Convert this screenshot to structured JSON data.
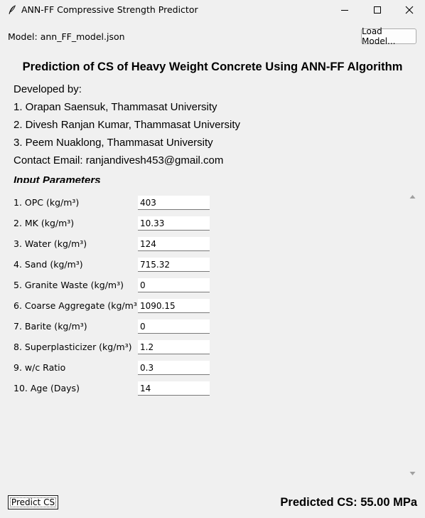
{
  "window": {
    "title": "ANN-FF Compressive Strength Predictor",
    "app_icon": "feather-icon",
    "controls": [
      "minimize-icon",
      "maximize-icon",
      "close-icon"
    ]
  },
  "toolbar": {
    "model_label": "Model: ann_FF_model.json",
    "load_button": "Load Model..."
  },
  "header": {
    "title": "Prediction of CS of Heavy Weight Concrete Using ANN-FF Algorithm"
  },
  "info": {
    "developed_by": "Developed by:",
    "authors": [
      "1. Orapan Saensuk, Thammasat University",
      "2. Divesh Ranjan Kumar, Thammasat University",
      "3. Peem Nuaklong, Thammasat University"
    ],
    "contact": "Contact Email: ranjandivesh453@gmail.com"
  },
  "inputs": {
    "section_label": "Input Parameters",
    "params": [
      {
        "label": "1. OPC (kg/m³)",
        "value": "403"
      },
      {
        "label": "2. MK (kg/m³)",
        "value": "10.33"
      },
      {
        "label": "3. Water (kg/m³)",
        "value": "124"
      },
      {
        "label": "4. Sand (kg/m³)",
        "value": "715.32"
      },
      {
        "label": "5. Granite Waste (kg/m³)",
        "value": "0"
      },
      {
        "label": "6. Coarse Aggregate (kg/m³)",
        "value": "1090.15"
      },
      {
        "label": "7. Barite (kg/m³)",
        "value": "0"
      },
      {
        "label": "8. Superplasticizer (kg/m³)",
        "value": "1.2"
      },
      {
        "label": "9. w/c Ratio",
        "value": "0.3"
      },
      {
        "label": "10. Age (Days)",
        "value": "14"
      }
    ]
  },
  "footer": {
    "predict_button": "Predict CS",
    "result": "Predicted CS: 55.00 MPa"
  },
  "colors": {
    "window_bg": "#f0f0f0",
    "input_bg": "#ffffff",
    "text": "#000000"
  }
}
